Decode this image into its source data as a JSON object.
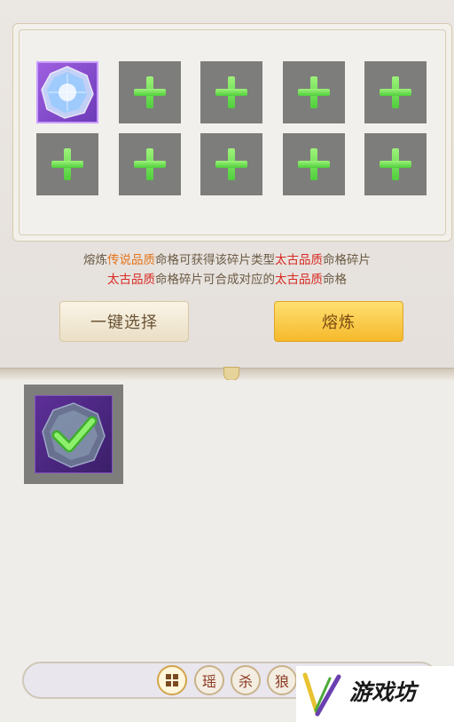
{
  "slots": [
    {
      "state": "filled",
      "item": "crystal-fragment-icon"
    },
    {
      "state": "empty"
    },
    {
      "state": "empty"
    },
    {
      "state": "empty"
    },
    {
      "state": "empty"
    },
    {
      "state": "empty"
    },
    {
      "state": "empty"
    },
    {
      "state": "empty"
    },
    {
      "state": "empty"
    },
    {
      "state": "empty"
    }
  ],
  "info": {
    "line1_a": "熔炼",
    "line1_b": "传说品质",
    "line1_c": "命格可获得该碎片类型",
    "line1_d": "太古品质",
    "line1_e": "命格碎片",
    "line2_a": "太古品质",
    "line2_b": "命格碎片可合成对应的",
    "line2_c": "太古品质",
    "line2_d": "命格"
  },
  "buttons": {
    "auto_select": "一键选择",
    "smelt": "熔炼"
  },
  "inventory": [
    {
      "item": "crystal-fragment-icon",
      "selected": true
    }
  ],
  "filters": {
    "all": "",
    "f1": "瑶",
    "f2": "杀",
    "f3": "狼"
  },
  "watermark": {
    "text": "游戏坊"
  },
  "colors": {
    "legendary": "#e2721a",
    "ancient": "#d82a22",
    "slot_empty": "#7d7d7b",
    "plus_green": "#5fd94a",
    "purple": "#6d3bb8"
  }
}
